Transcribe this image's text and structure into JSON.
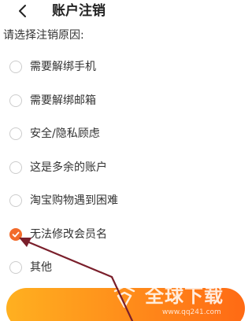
{
  "header": {
    "title": "账户注销",
    "back_icon": "chevron-left-icon"
  },
  "prompt": "请选择注销原因:",
  "reasons": [
    {
      "label": "需要解绑手机",
      "selected": false
    },
    {
      "label": "需要解绑邮箱",
      "selected": false
    },
    {
      "label": "安全/隐私顾虑",
      "selected": false
    },
    {
      "label": "这是多余的账户",
      "selected": false
    },
    {
      "label": "淘宝购物遇到困难",
      "selected": false
    },
    {
      "label": "无法修改会员名",
      "selected": true
    },
    {
      "label": "其他",
      "selected": false
    }
  ],
  "colors": {
    "accent": "#f26b2b",
    "button_start": "#ffb020",
    "button_end": "#ff6a14",
    "annotation_arrow": "#7a1f2b"
  },
  "watermark": {
    "text": "全球下载",
    "url": "www.qq241.com"
  }
}
